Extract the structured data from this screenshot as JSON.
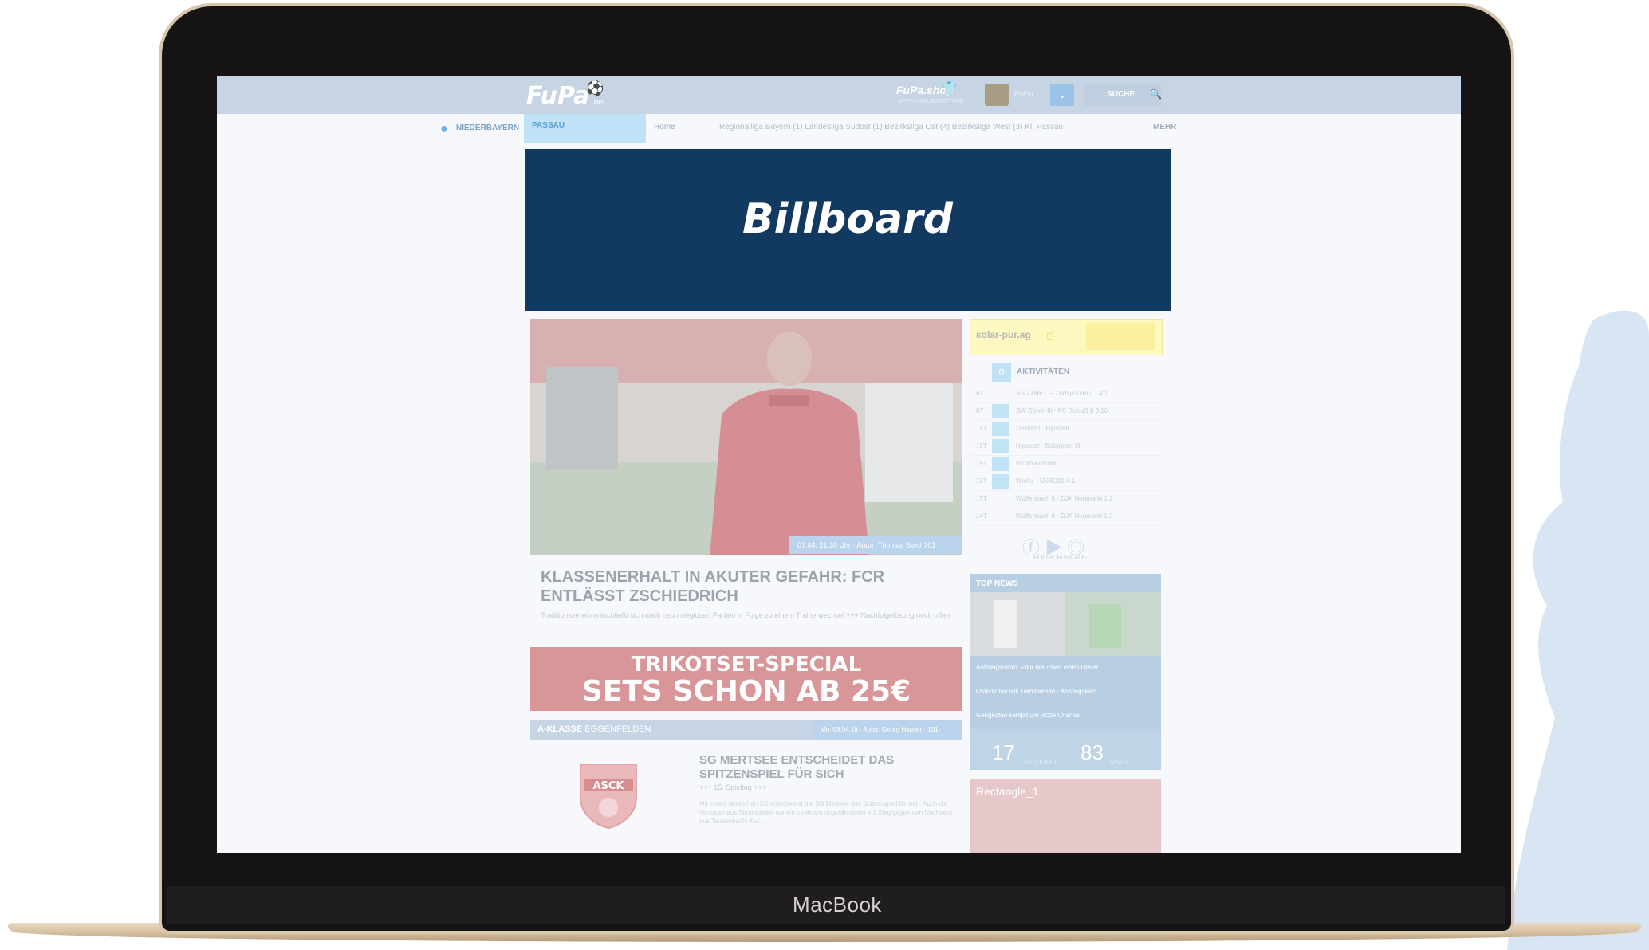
{
  "device": {
    "brand": "MacBook"
  },
  "header": {
    "logo": "FuPa",
    "logo_tld": ".net",
    "shop": "FuPa.shop",
    "shop_sub": "VEREINSAUSSTATTUNG",
    "user": "FuPa",
    "search": "SUCHE"
  },
  "nav": {
    "region": "NIEDERBAYERN",
    "active_tab": "PASSAU",
    "home": "Home",
    "leagues": "Regionalliga Bayern (1)   Landesliga Südost (1)   Bezirksliga Ost (4)   Bezirksliga West (3)   Kl. Passau",
    "more": "MEHR"
  },
  "billboard": {
    "label": "Billboard"
  },
  "hero": {
    "meta": "07.04. 21:30 Uhr · Autor: Thomas Seidl",
    "count": "701",
    "title": "KLASSENERHALT IN AKUTER GEFAHR: FCR ENTLÄSST ZSCHIEDRICH",
    "subtitle": "Traditionsverein entschließt sich nach neun sieglosen Partien in Folge zu einem Trainerwechsel +++ Nachfolgelösung noch offen"
  },
  "trikot_ad": {
    "line1": "TRIKOTSET-SPECIAL",
    "line2": "SETS SCHON AB 25€"
  },
  "a_klasse": {
    "label_bold": "A-KLASSE",
    "label_rest": " EGGENFELDEN",
    "meta": "Mo. 09.04.18 · Autor: Georg Hauser · 191",
    "crest": "ASCK",
    "title": "SG MERTSEE ENTSCHEIDET DAS SPITZENSPIEL FÜR SICH",
    "kicker": "+++ 15. Spieltag +++",
    "text": "Mit einem deutlichen 3:0 entscheidet die SG Mertsee das Spitzenspiel für sich. Auch die Verfolger aus Simbach/Inn kamen zu einem ungefährdeten 4:1 Sieg gegen den Nachbarn aus Taubenbach. Kuc ..."
  },
  "sidebar": {
    "solar": "solar-pur.ag",
    "activities_count": "0",
    "activities_title": "AKTIVITÄTEN",
    "activities": [
      {
        "time": "6T",
        "text": "SSG Ulm - FC Srbija Ulm I. - 4:1"
      },
      {
        "time": "6T",
        "text": "SW Düren III - FC Schloß II 3:10"
      },
      {
        "time": "15T",
        "text": "Deindorf - Hipstedt"
      },
      {
        "time": "15T",
        "text": "Hipstedt - Selsingen III"
      },
      {
        "time": "15T",
        "text": "Bruno Amorim"
      },
      {
        "time": "15T",
        "text": "Wieler - USBC01 4:1"
      },
      {
        "time": "15T",
        "text": "Woffenbach II - DJK Neumarkt 1:2"
      },
      {
        "time": "14T",
        "text": "Woffenbach II - DJK Neumarkt 1:2"
      }
    ],
    "social_label": "FOLGE FUPA AUF",
    "topnews_label": "TOP NEWS",
    "topnews": [
      "Aufsteigsruhm: »Wir brauchen einen Dreier...",
      "Osterhofen will Trendwende - Abstiegskam...",
      "Gengkofen kämpft um letzte Chance"
    ],
    "stats": [
      {
        "value": "17",
        "label": "LIVETICKER"
      },
      {
        "value": "83",
        "label": "SPIELE"
      }
    ],
    "rect": "Rectangle_1"
  },
  "colors": {
    "billboard": "#123a60",
    "topbar": "#c7d4e3",
    "accent": "#bfe2f7",
    "trikot": "#d99699",
    "rect": "#e6c7ca"
  }
}
